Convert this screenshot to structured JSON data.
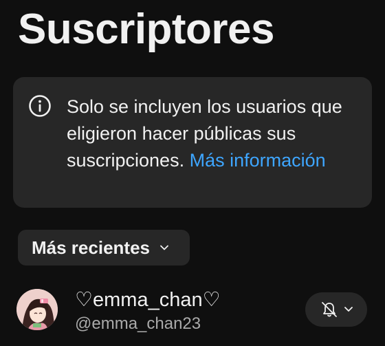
{
  "page": {
    "title": "Suscriptores"
  },
  "info_card": {
    "text": "Solo se incluyen los usuarios que eligieron hacer públicas sus suscripciones.",
    "link": "Más información",
    "icon": "info-icon"
  },
  "sort": {
    "label": "Más recientes",
    "icon": "chevron-down-icon"
  },
  "subscribers": [
    {
      "name": "♡emma_chan♡",
      "handle": "@emma_chan23",
      "avatar": "avatar",
      "notification_icon": "bell-off-icon"
    }
  ],
  "colors": {
    "background": "#0f0f0f",
    "card": "#272727",
    "text": "#f1f1f1",
    "secondary_text": "#aaaaaa",
    "link": "#3ea6ff"
  }
}
